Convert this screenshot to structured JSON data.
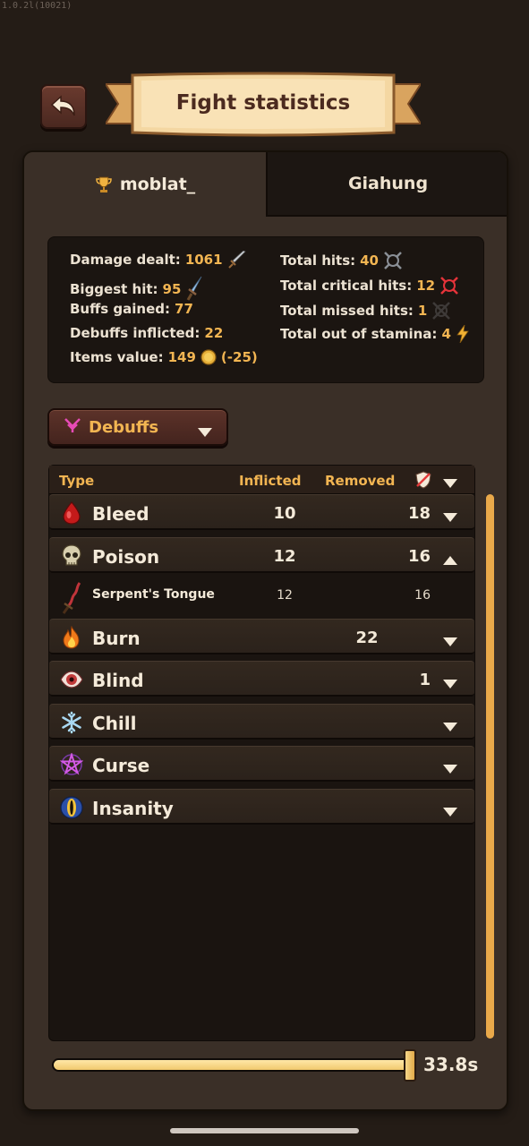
{
  "version": "1.0.2l(10021)",
  "header": {
    "title": "Fight statistics",
    "back_icon": "undo-arrow-icon"
  },
  "tabs": [
    {
      "label": "moblat_",
      "icon": "trophy-icon",
      "active": true
    },
    {
      "label": "Giahung",
      "active": false
    }
  ],
  "stats": {
    "damage_dealt": {
      "label": "Damage dealt:",
      "value": "1061",
      "icon": "sword-icon"
    },
    "biggest_hit": {
      "label": "Biggest hit:",
      "value": "95",
      "icon": "dagger-icon"
    },
    "buffs_gained": {
      "label": "Buffs gained:",
      "value": "77"
    },
    "debuffs_inflicted": {
      "label": "Debuffs inflicted:",
      "value": "22"
    },
    "items_value": {
      "label": "Items value:",
      "value": "149",
      "delta": "(-25)",
      "icon": "gold-coin-icon"
    },
    "total_hits": {
      "label": "Total hits:",
      "value": "40",
      "icon": "crosshair-icon"
    },
    "total_critical_hits": {
      "label": "Total critical hits:",
      "value": "12",
      "icon": "critical-crosshair-icon"
    },
    "total_missed_hits": {
      "label": "Total missed hits:",
      "value": "1",
      "icon": "miss-icon"
    },
    "total_out_of_stamina": {
      "label": "Total out of stamina:",
      "value": "4",
      "icon": "lightning-icon"
    }
  },
  "filter": {
    "selected": "Debuffs",
    "icon": "debuff-icon"
  },
  "table": {
    "headers": {
      "type": "Type",
      "inflicted": "Inflicted",
      "removed": "Removed",
      "cleanse_icon": "cleanse-shield-icon"
    },
    "rows": [
      {
        "name": "Bleed",
        "icon": "blood-drop-icon",
        "inflicted": "10",
        "removed": "18",
        "expanded": false
      },
      {
        "name": "Poison",
        "icon": "skull-icon",
        "inflicted": "12",
        "removed": "16",
        "expanded": true,
        "children": [
          {
            "name": "Serpent's Tongue",
            "icon": "serpent-blade-icon",
            "inflicted": "12",
            "removed": "16"
          }
        ]
      },
      {
        "name": "Burn",
        "icon": "flame-icon",
        "inflicted": "",
        "removed": "22",
        "expanded": false
      },
      {
        "name": "Blind",
        "icon": "eye-icon",
        "inflicted": "",
        "removed": "1",
        "expanded": false
      },
      {
        "name": "Chill",
        "icon": "snowflake-icon",
        "inflicted": "",
        "removed": "",
        "expanded": false
      },
      {
        "name": "Curse",
        "icon": "pentagram-icon",
        "inflicted": "",
        "removed": "",
        "expanded": false
      },
      {
        "name": "Insanity",
        "icon": "insanity-eye-icon",
        "inflicted": "",
        "removed": "",
        "expanded": false
      }
    ]
  },
  "timeline": {
    "label": "33.8s",
    "progress": 1.0
  },
  "colors": {
    "accent": "#f2b552",
    "panel": "#3a2f27",
    "background": "#241c16"
  }
}
